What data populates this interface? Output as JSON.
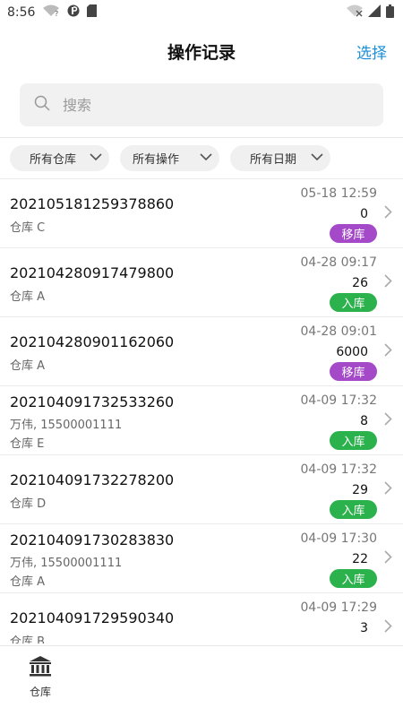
{
  "status_bar": {
    "time": "8:56"
  },
  "header": {
    "title": "操作记录",
    "action": "选择"
  },
  "search": {
    "placeholder": "搜索"
  },
  "filters": [
    {
      "label": "所有仓库"
    },
    {
      "label": "所有操作"
    },
    {
      "label": "所有日期"
    }
  ],
  "records": [
    {
      "id": "202105181259378860",
      "lines": [
        "仓库 C"
      ],
      "time": "05-18 12:59",
      "qty": "0",
      "badge": "移库",
      "badge_type": "move"
    },
    {
      "id": "202104280917479800",
      "lines": [
        "仓库 A"
      ],
      "time": "04-28 09:17",
      "qty": "26",
      "badge": "入库",
      "badge_type": "in"
    },
    {
      "id": "202104280901162060",
      "lines": [
        "仓库 A"
      ],
      "time": "04-28 09:01",
      "qty": "6000",
      "badge": "移库",
      "badge_type": "move"
    },
    {
      "id": "202104091732533260",
      "lines": [
        "万伟, 15500001111",
        "仓库 E"
      ],
      "time": "04-09 17:32",
      "qty": "8",
      "badge": "入库",
      "badge_type": "in"
    },
    {
      "id": "202104091732278200",
      "lines": [
        "仓库 D"
      ],
      "time": "04-09 17:32",
      "qty": "29",
      "badge": "入库",
      "badge_type": "in"
    },
    {
      "id": "202104091730283830",
      "lines": [
        "万伟, 15500001111",
        "仓库 A"
      ],
      "time": "04-09 17:30",
      "qty": "22",
      "badge": "入库",
      "badge_type": "in"
    },
    {
      "id": "202104091729590340",
      "lines": [
        "仓库 B"
      ],
      "time": "04-09 17:29",
      "qty": "3",
      "badge": "",
      "badge_type": ""
    }
  ],
  "tabbar": {
    "items": [
      {
        "label": "仓库",
        "icon": "bank-icon"
      }
    ]
  },
  "colors": {
    "accent": "#1a8fd6",
    "badge_move": "#a449c8",
    "badge_in": "#2bb24c"
  }
}
